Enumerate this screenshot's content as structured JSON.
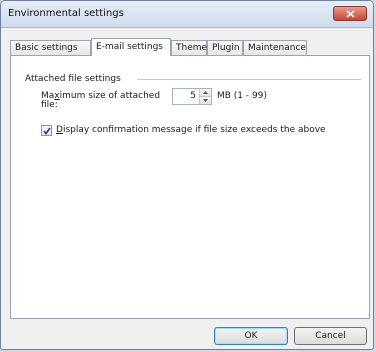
{
  "window": {
    "title": "Environmental settings"
  },
  "tabs": [
    {
      "label": "Basic settings"
    },
    {
      "label": "E-mail settings"
    },
    {
      "label": "Theme"
    },
    {
      "label": "Plugin"
    },
    {
      "label": "Maintenance"
    }
  ],
  "email": {
    "group_label": "Attached file settings",
    "max_size_label_pre": "Ma",
    "max_size_label_key": "x",
    "max_size_label_post": "imum size of attached file:",
    "max_size_value": "5",
    "unit_label": "MB (1 - 99)",
    "confirm_key": "D",
    "confirm_label_rest": "isplay confirmation message if file size exceeds the above",
    "confirm_checked": true
  },
  "buttons": {
    "ok": "OK",
    "cancel": "Cancel"
  },
  "colors": {
    "close_button": "#c74634",
    "default_button_border": "#3c7fb1"
  },
  "icons": {
    "close": "close-icon",
    "spin_up": "chevron-up-icon",
    "spin_down": "chevron-down-icon",
    "check": "check-icon"
  }
}
